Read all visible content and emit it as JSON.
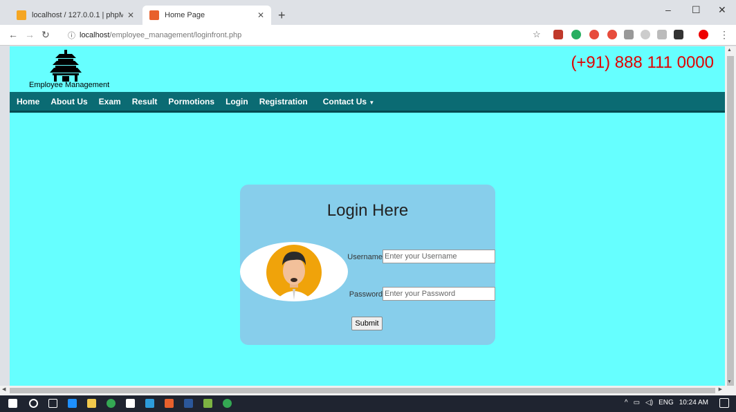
{
  "browser": {
    "tabs": [
      {
        "label": "localhost / 127.0.0.1 | phpMyAdm",
        "favicon": "phpmyadmin-icon",
        "active": false
      },
      {
        "label": "Home Page",
        "favicon": "page-icon",
        "active": true
      }
    ],
    "new_tab": "+",
    "window_controls": {
      "minimize": "–",
      "maximize": "☐",
      "close": "✕"
    },
    "url_host": "localhost",
    "url_path": "/employee_management/loginfront.php"
  },
  "header": {
    "brand": "Employee Management",
    "phone": "(+91) 888 111 0000"
  },
  "nav": {
    "items": [
      "Home",
      "About Us",
      "Exam",
      "Result",
      "Pormotions",
      "Login",
      "Registration"
    ],
    "contact": "Contact Us"
  },
  "login": {
    "title": "Login Here",
    "username_label": "Username",
    "username_placeholder": "Enter your Username",
    "password_label": "Password",
    "password_placeholder": "Enter your Password",
    "submit_label": "Submit"
  },
  "taskbar": {
    "tray_lang": "ENG",
    "time": "10:24 AM"
  },
  "colors": {
    "page_bg": "#66ffff",
    "navbar_bg": "#0b6b73",
    "card_bg": "#87ceeb",
    "phone_red": "#e00000"
  }
}
